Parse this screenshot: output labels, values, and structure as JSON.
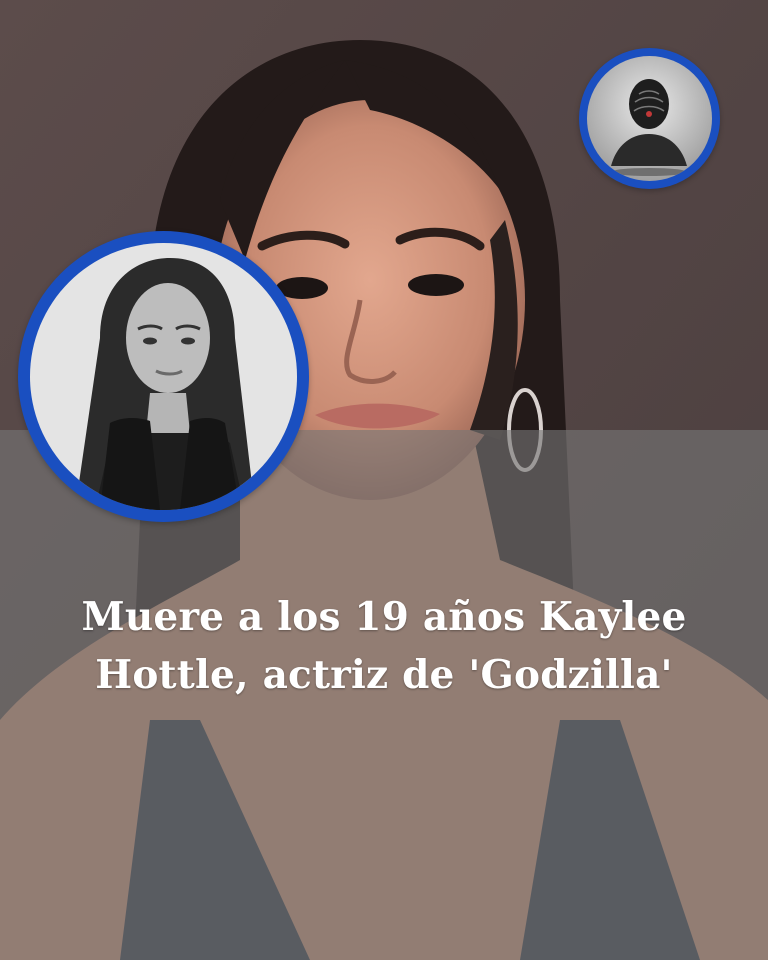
{
  "post": {
    "headline_line1": "Muere a los 19 años Kaylee",
    "headline_line2": "Hottle, actriz de 'Godzilla'"
  },
  "colors": {
    "ring": "#1a4fc0",
    "overlay": "#767676",
    "background": "#5a4b4a",
    "headline": "#ffffff"
  },
  "icons": {
    "top_right_badge": "fingerprint-profile-icon"
  }
}
